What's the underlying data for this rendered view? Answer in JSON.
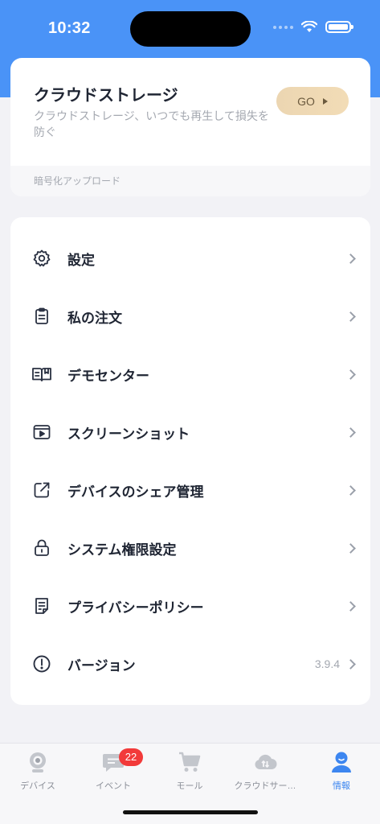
{
  "status_bar": {
    "time": "10:32"
  },
  "cloud_card": {
    "title": "クラウドストレージ",
    "description": "クラウドストレージ、いつでも再生して損失を防ぐ",
    "go_label": "GO",
    "footer": "暗号化アップロード",
    "go_colors": [
      "#ecd6b2",
      "#f2dcb6"
    ]
  },
  "menu": {
    "items": [
      {
        "label": "設定",
        "icon": "gear-icon",
        "value": ""
      },
      {
        "label": "私の注文",
        "icon": "clipboard-icon",
        "value": ""
      },
      {
        "label": "デモセンター",
        "icon": "book-icon",
        "value": ""
      },
      {
        "label": "スクリーンショット",
        "icon": "video-screen-icon",
        "value": ""
      },
      {
        "label": "デバイスのシェア管理",
        "icon": "share-out-icon",
        "value": ""
      },
      {
        "label": "システム権限設定",
        "icon": "lock-icon",
        "value": ""
      },
      {
        "label": "プライバシーポリシー",
        "icon": "document-icon",
        "value": ""
      },
      {
        "label": "バージョン",
        "icon": "info-icon",
        "value": "3.9.4"
      }
    ]
  },
  "tab_bar": {
    "tabs": [
      {
        "label": "デバイス",
        "icon": "camera-icon",
        "active": false
      },
      {
        "label": "イベント",
        "icon": "chat-icon",
        "active": false,
        "badge": "22"
      },
      {
        "label": "モール",
        "icon": "cart-icon",
        "active": false
      },
      {
        "label": "クラウドサー…",
        "icon": "cloud-icon",
        "active": false
      },
      {
        "label": "情報",
        "icon": "person-icon",
        "active": true
      }
    ]
  },
  "colors": {
    "header_blue": "#4a93f7",
    "active_tab": "#3d86f0",
    "badge_red": "#f23a3a"
  }
}
